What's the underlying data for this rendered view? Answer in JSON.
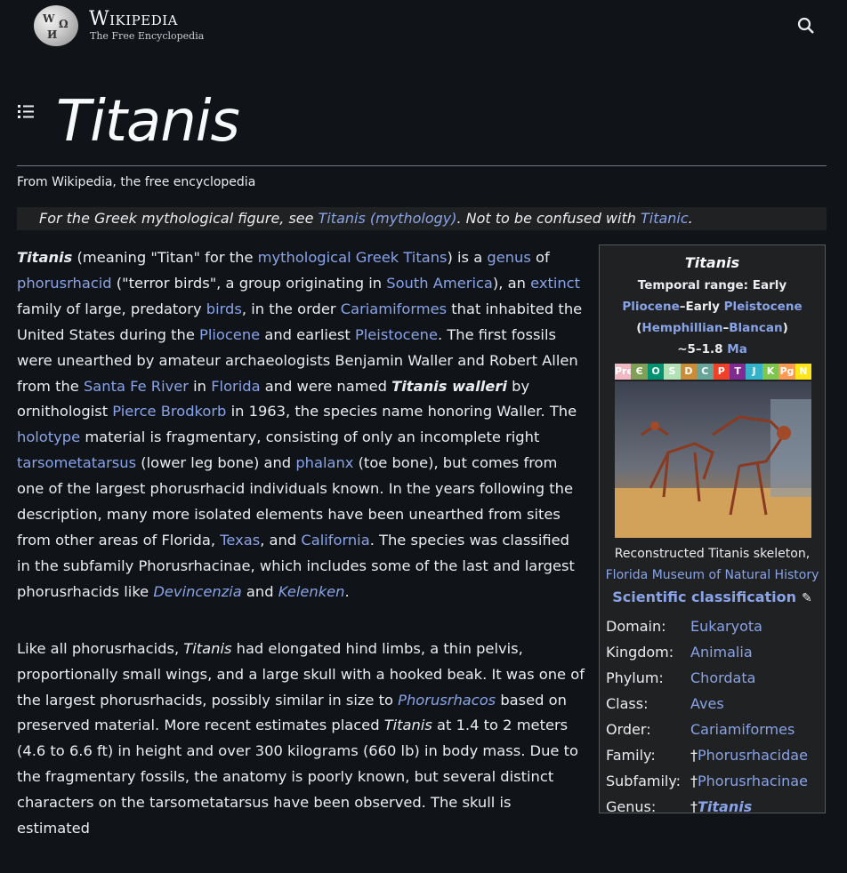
{
  "header": {
    "wordmark": "Wikipedia",
    "tagline": "The Free Encyclopedia",
    "search_icon": "search-icon",
    "toc_icon": "list-icon"
  },
  "article": {
    "title": "Titanis",
    "from_line": "From Wikipedia, the free encyclopedia",
    "hatnote": {
      "pre": "For the Greek mythological figure, see ",
      "link1": "Titanis (mythology)",
      "mid": ". Not to be confused with ",
      "link2": "Titanic",
      "post": "."
    },
    "p1": {
      "t1": "Titanis",
      "t2": " (meaning \"Titan\" for the ",
      "l1": "mythological Greek Titans",
      "t3": ") is a ",
      "l2": "genus",
      "t4": " of ",
      "l3": "phorusrhacid",
      "t5": " (\"terror birds\", a group originating in ",
      "l4": "South America",
      "t6": "), an ",
      "l5": "extinct",
      "t7": " family of large, predatory ",
      "l6": "birds",
      "t8": ", in the order ",
      "l7": "Cariamiformes",
      "t9": " that inhabited the United States during the ",
      "l8": "Pliocene",
      "t10": " and earliest ",
      "l9": "Pleistocene",
      "t11": ". The first fossils were unearthed by amateur archaeologists Benjamin Waller and Robert Allen from the ",
      "l10": "Santa Fe River",
      "t12": " in ",
      "l11": "Florida",
      "t13": " and were named ",
      "t14": "Titanis walleri",
      "t15": " by ornithologist ",
      "l12": "Pierce Brodkorb",
      "t16": " in 1963, the species name honoring Waller. The ",
      "l13": "holotype",
      "t17": " material is fragmentary, consisting of only an incomplete right ",
      "l14": "tarsometatarsus",
      "t18": " (lower leg bone) and ",
      "l15": "phalanx",
      "t19": " (toe bone), but comes from one of the largest phorusrhacid individuals known. In the years following the description, many more isolated elements have been unearthed from sites from other areas of Florida, ",
      "l16": "Texas",
      "t20": ", and ",
      "l17": "California",
      "t21": ". The species was classified in the subfamily Phorusrhacinae, which includes some of the last and largest phorusrhacids like ",
      "l18": "Devincenzia",
      "t22": " and ",
      "l19": "Kelenken",
      "t23": "."
    },
    "p2": {
      "t1": "Like all phorusrhacids, ",
      "t2": "Titanis",
      "t3": " had elongated hind limbs, a thin pelvis, proportionally small wings, and a large skull with a hooked beak. It was one of the largest phorusrhacids, possibly similar in size to ",
      "l1": "Phorusrhacos",
      "t4": " based on preserved material. More recent estimates placed ",
      "t5": "Titanis",
      "t6": " at 1.4 to 2 meters (4.6 to 6.6 ft) in height and over 300 kilograms (660 lb) in body mass. Due to the fragmentary fossils, the anatomy is poorly known, but several distinct characters on the tarsometatarsus have been observed. The skull is estimated"
    }
  },
  "infobox": {
    "title": "Titanis",
    "range_label": "Temporal range: Early ",
    "range_l1": "Pliocene",
    "range_dash1": "–Early ",
    "range_l2": "Pleistocene",
    "range_open": " (",
    "range_l3": "Hemphillian",
    "range_dash2": "–",
    "range_l4": "Blancan",
    "range_close": ")",
    "range_ma": "~5–1.8 ",
    "range_ma_link": "Ma",
    "timeline": [
      {
        "label": "PreЄ",
        "color": "#f0b8c2"
      },
      {
        "label": "Є",
        "color": "#7fa056"
      },
      {
        "label": "O",
        "color": "#009270"
      },
      {
        "label": "S",
        "color": "#b3e1b6"
      },
      {
        "label": "D",
        "color": "#cb8c37"
      },
      {
        "label": "C",
        "color": "#67a599"
      },
      {
        "label": "P",
        "color": "#f04028"
      },
      {
        "label": "T",
        "color": "#812b92"
      },
      {
        "label": "J",
        "color": "#34b2c9"
      },
      {
        "label": "K",
        "color": "#7fc64e"
      },
      {
        "label": "Pg",
        "color": "#fd9a52"
      },
      {
        "label": "N",
        "color": "#ffe619"
      }
    ],
    "caption": "Reconstructed Titanis skeleton, ",
    "caption_link": "Florida Museum of Natural History",
    "sci_class": "Scientific classification",
    "pencil_icon": "pencil-icon",
    "rows": [
      {
        "k": "Domain:",
        "v": "Eukaryota",
        "dagger": ""
      },
      {
        "k": "Kingdom:",
        "v": "Animalia",
        "dagger": ""
      },
      {
        "k": "Phylum:",
        "v": "Chordata",
        "dagger": ""
      },
      {
        "k": "Class:",
        "v": "Aves",
        "dagger": ""
      },
      {
        "k": "Order:",
        "v": "Cariamiformes",
        "dagger": ""
      },
      {
        "k": "Family:",
        "v": "Phorusrhacidae",
        "dagger": "†"
      },
      {
        "k": "Subfamily:",
        "v": "Phorusrhacinae",
        "dagger": "†"
      },
      {
        "k": "Genus:",
        "v": "Titanis",
        "dagger": "†"
      }
    ]
  }
}
